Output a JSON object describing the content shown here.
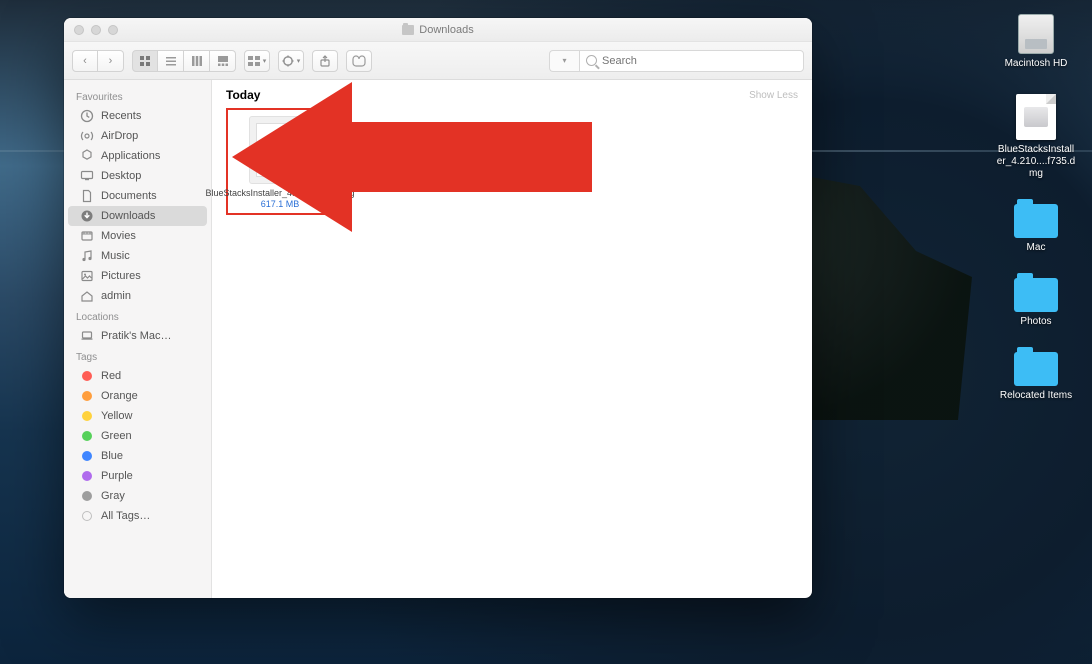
{
  "window": {
    "title": "Downloads",
    "show_less": "Show Less",
    "section_head": "Today"
  },
  "toolbar": {
    "back": "‹",
    "forward": "›",
    "share_icon": "share-icon",
    "tags_icon": "tag-icon",
    "search_placeholder": "Search"
  },
  "sidebar": {
    "sections": [
      {
        "header": "Favourites",
        "items": [
          {
            "icon": "clock",
            "label": "Recents"
          },
          {
            "icon": "airdrop",
            "label": "AirDrop"
          },
          {
            "icon": "apps",
            "label": "Applications"
          },
          {
            "icon": "desktop",
            "label": "Desktop"
          },
          {
            "icon": "doc",
            "label": "Documents"
          },
          {
            "icon": "download",
            "label": "Downloads",
            "selected": true
          },
          {
            "icon": "movie",
            "label": "Movies"
          },
          {
            "icon": "music",
            "label": "Music"
          },
          {
            "icon": "picture",
            "label": "Pictures"
          },
          {
            "icon": "home",
            "label": "admin"
          }
        ]
      },
      {
        "header": "Locations",
        "items": [
          {
            "icon": "laptop",
            "label": "Pratik's Mac…"
          }
        ]
      },
      {
        "header": "Tags",
        "items": [
          {
            "tag": "#ff5d55",
            "label": "Red"
          },
          {
            "tag": "#ff9e3d",
            "label": "Orange"
          },
          {
            "tag": "#ffd23d",
            "label": "Yellow"
          },
          {
            "tag": "#56d15a",
            "label": "Green"
          },
          {
            "tag": "#3f86ff",
            "label": "Blue"
          },
          {
            "tag": "#b06bed",
            "label": "Purple"
          },
          {
            "tag": "#9e9e9e",
            "label": "Gray"
          },
          {
            "tag": "ring",
            "label": "All Tags…"
          }
        ]
      }
    ]
  },
  "file": {
    "name": "BlueStacksInstaller_4.210....446.dmg",
    "size": "617.1 MB"
  },
  "desktop_icons": [
    {
      "kind": "hd",
      "label": "Macintosh HD"
    },
    {
      "kind": "dmg",
      "label": "BlueStacksInstaller_4.210....f735.dmg"
    },
    {
      "kind": "folder",
      "label": "Mac"
    },
    {
      "kind": "folder",
      "label": "Photos"
    },
    {
      "kind": "folder",
      "label": "Relocated Items"
    }
  ]
}
